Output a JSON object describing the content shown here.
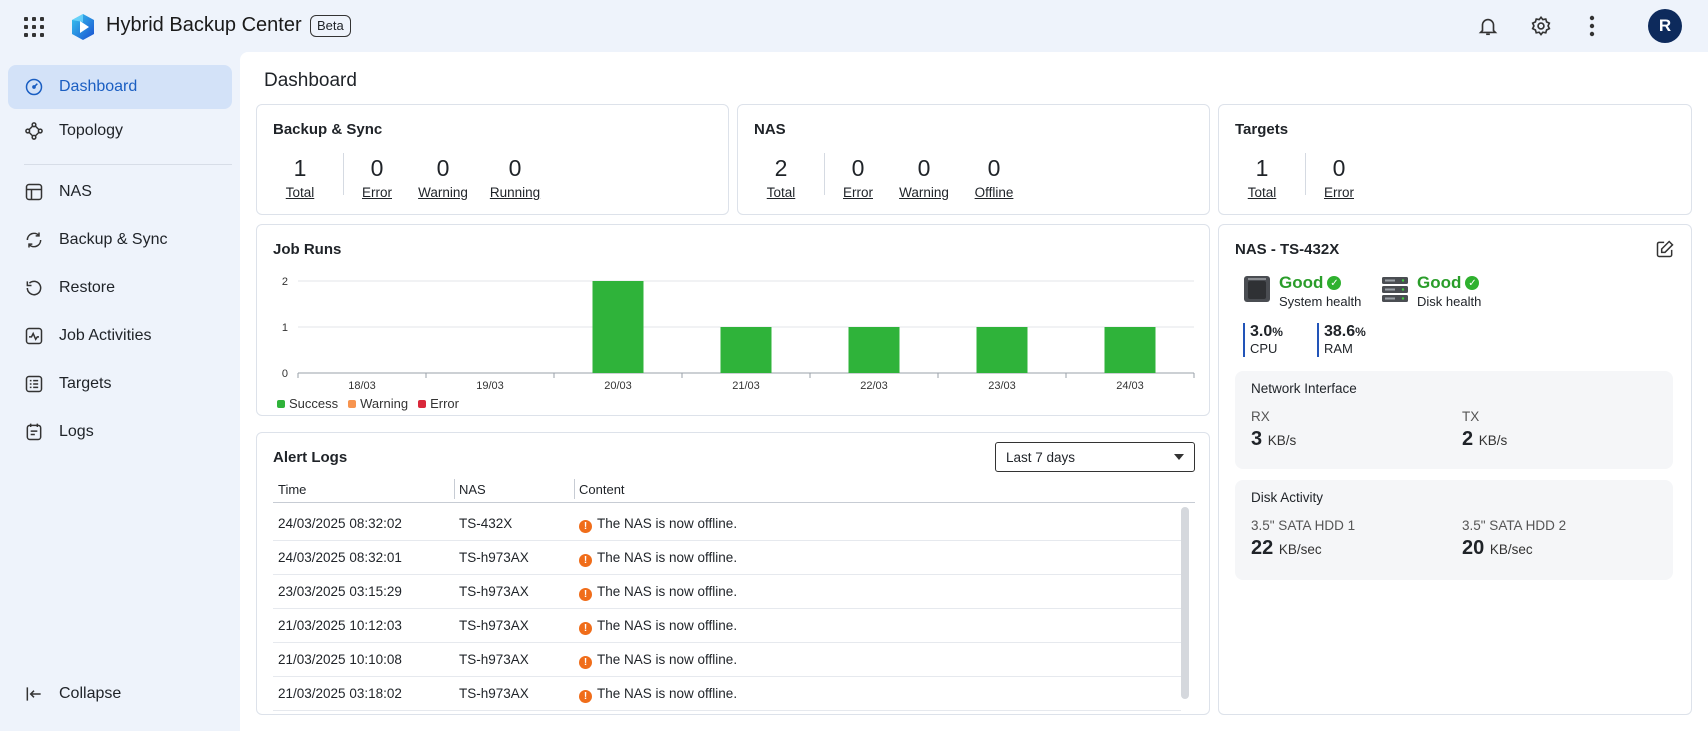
{
  "app": {
    "title": "Hybrid Backup Center",
    "badge": "Beta",
    "avatar_initial": "R"
  },
  "sidebar": {
    "items": [
      {
        "label": "Dashboard",
        "icon": "dashboard-icon",
        "active": true
      },
      {
        "label": "Topology",
        "icon": "topology-icon"
      },
      {
        "label": "NAS",
        "icon": "nas-icon"
      },
      {
        "label": "Backup & Sync",
        "icon": "sync-icon"
      },
      {
        "label": "Restore",
        "icon": "restore-icon"
      },
      {
        "label": "Job Activities",
        "icon": "activity-icon"
      },
      {
        "label": "Targets",
        "icon": "targets-icon"
      },
      {
        "label": "Logs",
        "icon": "logs-icon"
      }
    ],
    "collapse_label": "Collapse"
  },
  "page": {
    "title": "Dashboard"
  },
  "backup_sync": {
    "title": "Backup & Sync",
    "stats": [
      {
        "value": "1",
        "label": "Total"
      },
      {
        "value": "0",
        "label": "Error"
      },
      {
        "value": "0",
        "label": "Warning"
      },
      {
        "value": "0",
        "label": "Running"
      }
    ]
  },
  "nas_summary": {
    "title": "NAS",
    "stats": [
      {
        "value": "2",
        "label": "Total"
      },
      {
        "value": "0",
        "label": "Error"
      },
      {
        "value": "0",
        "label": "Warning"
      },
      {
        "value": "0",
        "label": "Offline"
      }
    ]
  },
  "targets": {
    "title": "Targets",
    "stats": [
      {
        "value": "1",
        "label": "Total"
      },
      {
        "value": "0",
        "label": "Error"
      }
    ]
  },
  "job_runs": {
    "title": "Job Runs",
    "legend": [
      {
        "label": "Success",
        "color": "#2fb33a"
      },
      {
        "label": "Warning",
        "color": "#f7944f"
      },
      {
        "label": "Error",
        "color": "#d9283a"
      }
    ]
  },
  "chart_data": {
    "type": "bar",
    "title": "Job Runs",
    "categories": [
      "18/03",
      "19/03",
      "20/03",
      "21/03",
      "22/03",
      "23/03",
      "24/03"
    ],
    "series": [
      {
        "name": "Success",
        "values": [
          0,
          0,
          2,
          1,
          1,
          1,
          1
        ],
        "color": "#2fb33a"
      },
      {
        "name": "Warning",
        "values": [
          0,
          0,
          0,
          0,
          0,
          0,
          0
        ],
        "color": "#f7944f"
      },
      {
        "name": "Error",
        "values": [
          0,
          0,
          0,
          0,
          0,
          0,
          0
        ],
        "color": "#d9283a"
      }
    ],
    "ylim": [
      0,
      2
    ],
    "yticks": [
      0,
      1,
      2
    ],
    "grid": true,
    "legend": "bottom-left",
    "xlabel": "",
    "ylabel": ""
  },
  "alert_logs": {
    "title": "Alert Logs",
    "range": "Last 7 days",
    "columns": [
      "Time",
      "NAS",
      "Content"
    ],
    "rows": [
      {
        "time": "24/03/2025 08:32:02",
        "nas": "TS-432X",
        "content": "The NAS is now offline."
      },
      {
        "time": "24/03/2025 08:32:01",
        "nas": "TS-h973AX",
        "content": "The NAS is now offline."
      },
      {
        "time": "23/03/2025 03:15:29",
        "nas": "TS-h973AX",
        "content": "The NAS is now offline."
      },
      {
        "time": "21/03/2025 10:12:03",
        "nas": "TS-h973AX",
        "content": "The NAS is now offline."
      },
      {
        "time": "21/03/2025 10:10:08",
        "nas": "TS-h973AX",
        "content": "The NAS is now offline."
      },
      {
        "time": "21/03/2025 03:18:02",
        "nas": "TS-h973AX",
        "content": "The NAS is now offline."
      }
    ]
  },
  "nas_detail": {
    "title": "NAS - TS-432X",
    "system_health": {
      "status": "Good",
      "label": "System health"
    },
    "disk_health": {
      "status": "Good",
      "label": "Disk health"
    },
    "cpu": {
      "value": "3.0",
      "unit": "%",
      "label": "CPU"
    },
    "ram": {
      "value": "38.6",
      "unit": "%",
      "label": "RAM"
    },
    "network": {
      "title": "Network Interface",
      "rx": {
        "label": "RX",
        "value": "3",
        "unit": "KB/s"
      },
      "tx": {
        "label": "TX",
        "value": "2",
        "unit": "KB/s"
      }
    },
    "disk_activity": {
      "title": "Disk Activity",
      "disks": [
        {
          "label": "3.5\" SATA HDD 1",
          "value": "22",
          "unit": "KB/sec"
        },
        {
          "label": "3.5\" SATA HDD 2",
          "value": "20",
          "unit": "KB/sec"
        }
      ]
    }
  },
  "colors": {
    "accent": "#1a5ec2",
    "success": "#2fb33a",
    "warning_icon": "#f06d1a",
    "good_text": "#2a9d2a"
  }
}
